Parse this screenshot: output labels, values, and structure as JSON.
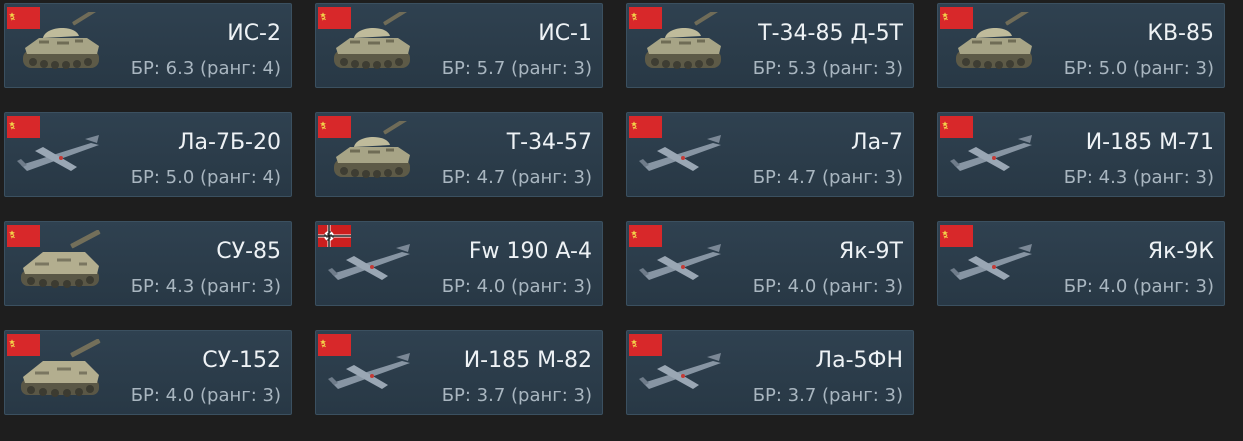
{
  "colors": {
    "background": "#1e1e1e",
    "card": "#2f4150",
    "title": "#eef2f5",
    "subtitle": "#a9b6c0",
    "ussr_flag": "#d8282a",
    "german_flag": "#cc1f1f"
  },
  "vehicles": [
    {
      "name": "ИС-2",
      "br": "БР: 6.3 (ранг: 4)",
      "nation": "ussr",
      "kind": "tank"
    },
    {
      "name": "ИС-1",
      "br": "БР: 5.7 (ранг: 3)",
      "nation": "ussr",
      "kind": "tank"
    },
    {
      "name": "Т-34-85 Д-5Т",
      "br": "БР: 5.3 (ранг: 3)",
      "nation": "ussr",
      "kind": "tank"
    },
    {
      "name": "КВ-85",
      "br": "БР: 5.0 (ранг: 3)",
      "nation": "ussr",
      "kind": "tank"
    },
    {
      "name": "Ла-7Б-20",
      "br": "БР: 5.0 (ранг: 4)",
      "nation": "ussr",
      "kind": "plane"
    },
    {
      "name": "Т-34-57",
      "br": "БР: 4.7 (ранг: 3)",
      "nation": "ussr",
      "kind": "tank"
    },
    {
      "name": "Ла-7",
      "br": "БР: 4.7 (ранг: 3)",
      "nation": "ussr",
      "kind": "plane"
    },
    {
      "name": "И-185 М-71",
      "br": "БР: 4.3 (ранг: 3)",
      "nation": "ussr",
      "kind": "plane"
    },
    {
      "name": "СУ-85",
      "br": "БР: 4.3 (ранг: 3)",
      "nation": "ussr",
      "kind": "spg"
    },
    {
      "name": "Fw 190 A-4",
      "br": "БР: 4.0 (ранг: 3)",
      "nation": "germany",
      "kind": "plane"
    },
    {
      "name": "Як-9Т",
      "br": "БР: 4.0 (ранг: 3)",
      "nation": "ussr",
      "kind": "plane"
    },
    {
      "name": "Як-9К",
      "br": "БР: 4.0 (ранг: 3)",
      "nation": "ussr",
      "kind": "plane"
    },
    {
      "name": "СУ-152",
      "br": "БР: 4.0 (ранг: 3)",
      "nation": "ussr",
      "kind": "spg"
    },
    {
      "name": "И-185 М-82",
      "br": "БР: 3.7 (ранг: 3)",
      "nation": "ussr",
      "kind": "plane"
    },
    {
      "name": "Ла-5ФН",
      "br": "БР: 3.7 (ранг: 3)",
      "nation": "ussr",
      "kind": "plane"
    }
  ]
}
